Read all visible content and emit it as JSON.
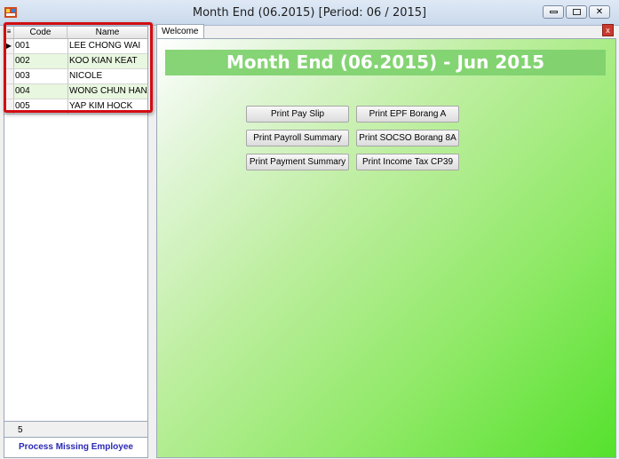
{
  "window": {
    "title": "Month End (06.2015) [Period: 06 / 2015]",
    "minimize_glyph": "",
    "maximize_glyph": "",
    "close_glyph": ""
  },
  "employee_grid": {
    "columns": [
      "Code",
      "Name"
    ],
    "rows": [
      {
        "code": "001",
        "name": "LEE CHONG WAI"
      },
      {
        "code": "002",
        "name": "KOO KIAN KEAT"
      },
      {
        "code": "003",
        "name": "NICOLE"
      },
      {
        "code": "004",
        "name": "WONG CHUN HAN"
      },
      {
        "code": "005",
        "name": "YAP KIM HOCK"
      }
    ],
    "row_count": "5",
    "process_link": "Process Missing Employee"
  },
  "tabs": [
    {
      "label": "Welcome",
      "close": "x"
    }
  ],
  "main": {
    "heading": "Month End (06.2015) - Jun 2015",
    "buttons": {
      "print_pay_slip": "Print Pay Slip",
      "print_epf_borang_a": "Print EPF Borang A",
      "print_payroll_summary": "Print Payroll Summary",
      "print_socso_borang_8a": "Print SOCSO Borang 8A",
      "print_payment_summary": "Print Payment Summary",
      "print_income_tax_cp39": "Print Income Tax CP39"
    }
  },
  "colors": {
    "highlight": "#d20d12",
    "banner": "#7fd26f",
    "row_alt": "#e8f7df",
    "link": "#2a2ab5"
  }
}
